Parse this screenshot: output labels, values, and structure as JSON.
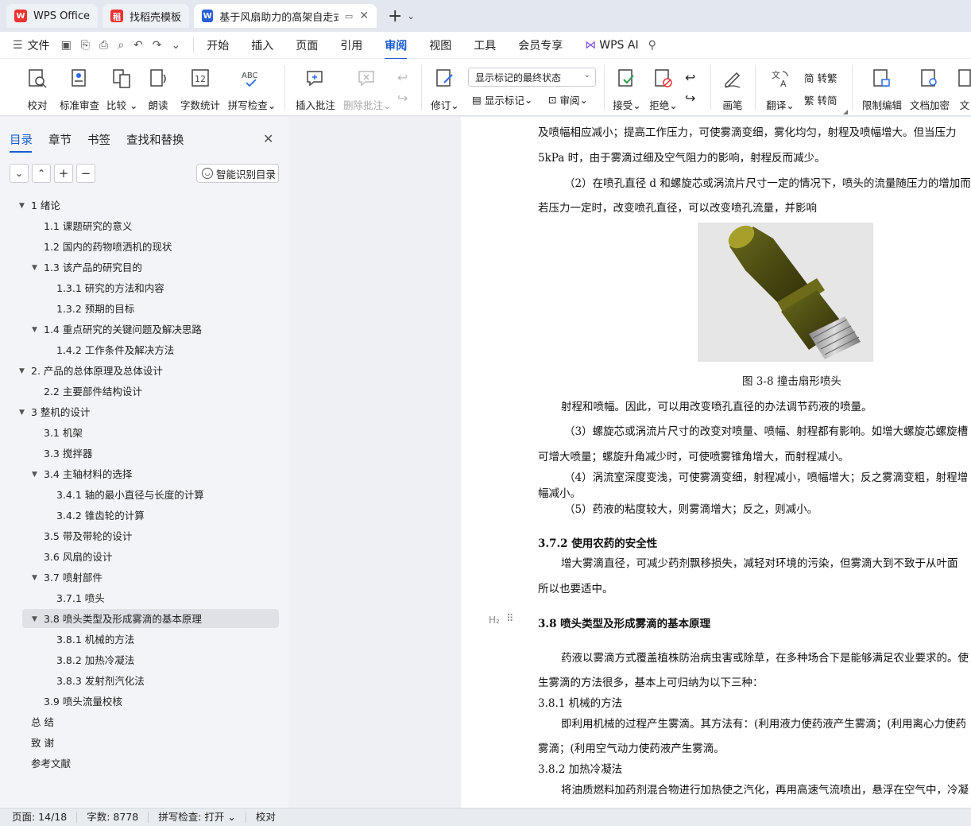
{
  "tabs": [
    {
      "label": "WPS Office",
      "icon": "wps-logo-icon",
      "color": "#e33"
    },
    {
      "label": "找稻壳模板",
      "icon": "docer-icon",
      "color": "#e33"
    },
    {
      "label": "基于风扇助力的高架自走式棉",
      "icon": "writer-doc-icon",
      "color": "#2b5fd9"
    }
  ],
  "menu": {
    "file": "文件",
    "items": [
      "开始",
      "插入",
      "页面",
      "引用",
      "审阅",
      "视图",
      "工具",
      "会员专享"
    ],
    "active": "审阅",
    "ai": "WPS AI"
  },
  "ribbon": {
    "proofread": "校对",
    "standard_review": "标准审查",
    "compare": "比较",
    "read_aloud": "朗读",
    "word_count": "字数统计",
    "spell_check": "拼写检查",
    "insert_comment": "插入批注",
    "delete_comment": "删除批注",
    "revise": "修订",
    "display_mode": "显示标记的最终状态",
    "show_markup": "显示标记",
    "review": "审阅",
    "accept": "接受",
    "reject": "拒绝",
    "pen": "画笔",
    "translate": "翻译",
    "to_simplified": "转繁",
    "to_traditional": "转简",
    "restrict_edit": "限制编辑",
    "encrypt": "文档加密",
    "more": "文"
  },
  "nav": {
    "tabs": [
      "目录",
      "章节",
      "书签",
      "查找和替换"
    ],
    "smart_btn": "智能识别目录",
    "toc": [
      {
        "text": "1  绪论",
        "level": 0,
        "arrow": true
      },
      {
        "text": "1.1 课题研究的意义",
        "level": 1,
        "arrow": false
      },
      {
        "text": "1.2 国内的药物喷洒机的现状",
        "level": 1,
        "arrow": false
      },
      {
        "text": "1.3  该产品的研究目的",
        "level": 1,
        "arrow": true
      },
      {
        "text": "1.3.1  研究的方法和内容",
        "level": 2,
        "arrow": false
      },
      {
        "text": "1.3.2 预期的目标",
        "level": 2,
        "arrow": false
      },
      {
        "text": "1.4 重点研究的关键问题及解决思路",
        "level": 1,
        "arrow": true
      },
      {
        "text": "1.4.2 工作条件及解决方法",
        "level": 2,
        "arrow": false
      },
      {
        "text": "2.  产品的总体原理及总体设计",
        "level": 0,
        "arrow": true
      },
      {
        "text": "2.2  主要部件结构设计",
        "level": 1,
        "arrow": false
      },
      {
        "text": "3  整机的设计",
        "level": 0,
        "arrow": true
      },
      {
        "text": "3.1  机架",
        "level": 1,
        "arrow": false
      },
      {
        "text": "3.3  搅拌器",
        "level": 1,
        "arrow": false
      },
      {
        "text": "3.4  主轴材料的选择",
        "level": 1,
        "arrow": true
      },
      {
        "text": "3.4.1  轴的最小直径与长度的计算",
        "level": 2,
        "arrow": false
      },
      {
        "text": "3.4.2  锥齿轮的计算",
        "level": 2,
        "arrow": false
      },
      {
        "text": "3.5  带及带轮的设计",
        "level": 1,
        "arrow": false
      },
      {
        "text": "3.6  风扇的设计",
        "level": 1,
        "arrow": false
      },
      {
        "text": "3.7 喷射部件",
        "level": 1,
        "arrow": true
      },
      {
        "text": "3.7.1  喷头",
        "level": 2,
        "arrow": false
      },
      {
        "text": "3.8 喷头类型及形成雾滴的基本原理",
        "level": 1,
        "arrow": true,
        "selected": true
      },
      {
        "text": "3.8.1  机械的方法",
        "level": 2,
        "arrow": false
      },
      {
        "text": "3.8.2  加热冷凝法",
        "level": 2,
        "arrow": false
      },
      {
        "text": "3.8.3  发射剂汽化法",
        "level": 2,
        "arrow": false
      },
      {
        "text": "3.9  喷头流量校核",
        "level": 1,
        "arrow": false
      },
      {
        "text": "总   结",
        "level": 0,
        "arrow": false
      },
      {
        "text": "致   谢",
        "level": 0,
        "arrow": false
      },
      {
        "text": "参考文献",
        "level": 0,
        "arrow": false
      }
    ]
  },
  "doc": {
    "lines": [
      "及喷幅相应减小；提高工作压力，可使雾滴变细，雾化均匀，射程及喷幅增大。但当压力",
      "5kPa 时，由于雾滴过细及空气阻力的影响，射程反而减少。",
      "（2）在喷孔直径 d 和螺旋芯或涡流片尺寸一定的情况下，喷头的流量随压力的增加而",
      "若压力一定时，改变喷孔直径，可以改变喷孔流量，并影响",
      "射程和喷幅。因此，可以用改变喷孔直径的办法调节药液的喷量。",
      "（3）螺旋芯或涡流片尺寸的改变对喷量、喷幅、射程都有影响。如增大螺旋芯螺旋槽",
      "可增大喷量；螺旋升角减少时，可使喷雾锥角增大，而射程减小。",
      "（4）涡流室深度变浅，可使雾滴变细，射程减小，喷幅增大；反之雾滴变粗，射程增",
      "幅减小。",
      "（5）药液的粘度较大，则雾滴增大；反之，则减小。",
      "3.7.2  使用农药的安全性",
      "增大雾滴直径，可减少药剂飘移损失，减轻对环境的污染，但雾滴大到不致于从叶面",
      "所以也要适中。",
      "3.8 喷头类型及形成雾滴的基本原理",
      "药液以雾滴方式覆盖植株防治病虫害或除草，在多种场合下是能够满足农业要求的。使",
      "生雾滴的方法很多，基本上可归纳为以下三种：",
      "3.8.1  机械的方法",
      "即利用机械的过程产生雾滴。其方法有：(利用液力使药液产生雾滴；(利用离心力使药",
      "雾滴；(利用空气动力使药液产生雾滴。",
      "3.8.2  加热冷凝法",
      "将油质燃料加药剂混合物进行加热使之汽化，再用高速气流喷出，悬浮在空气中，冷凝"
    ],
    "caption": "图 3-8 撞击扇形喷头",
    "h2_mark": "H₂"
  },
  "status": {
    "page": "页面: 14/18",
    "words": "字数: 8778",
    "spell": "拼写检查: 打开",
    "proof": "校对"
  }
}
